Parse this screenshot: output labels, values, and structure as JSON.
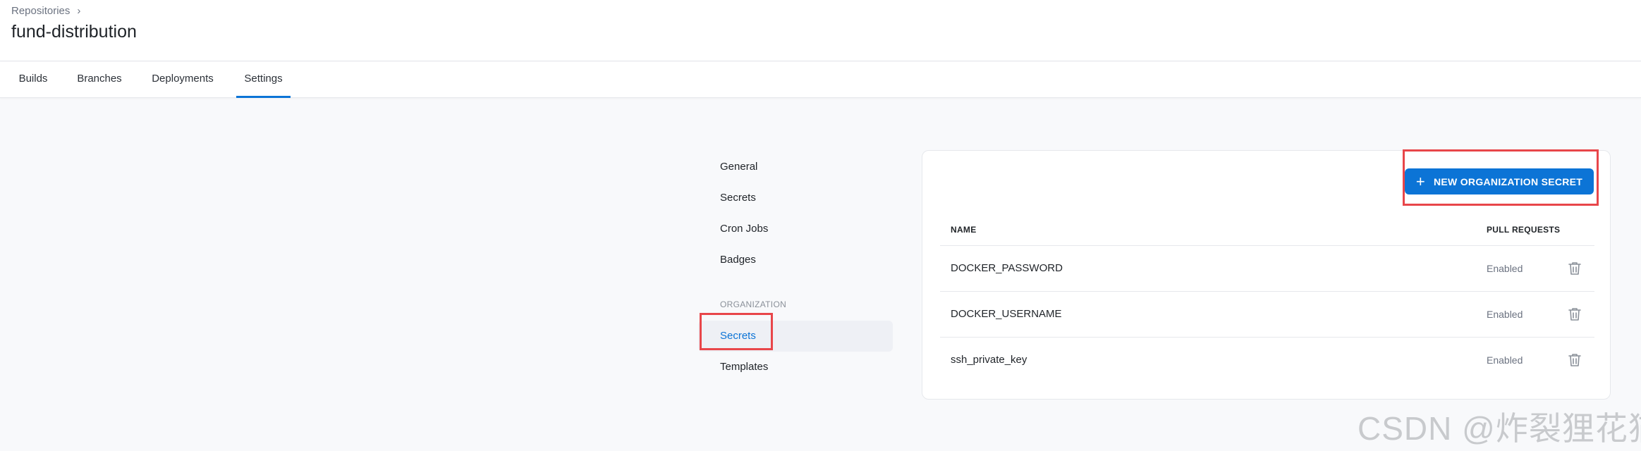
{
  "header": {
    "breadcrumb": "Repositories",
    "title": "fund-distribution"
  },
  "tabs": [
    {
      "label": "Builds"
    },
    {
      "label": "Branches"
    },
    {
      "label": "Deployments"
    },
    {
      "label": "Settings",
      "active": true
    }
  ],
  "sidebar": {
    "items": [
      {
        "label": "General"
      },
      {
        "label": "Secrets"
      },
      {
        "label": "Cron Jobs"
      },
      {
        "label": "Badges"
      }
    ],
    "section_label": "ORGANIZATION",
    "org_items": [
      {
        "label": "Secrets",
        "active": true
      },
      {
        "label": "Templates"
      }
    ]
  },
  "panel": {
    "new_button_label": "NEW ORGANIZATION SECRET",
    "columns": [
      "NAME",
      "PULL REQUESTS"
    ],
    "rows": [
      {
        "name": "DOCKER_PASSWORD",
        "pull_requests": "Enabled"
      },
      {
        "name": "DOCKER_USERNAME",
        "pull_requests": "Enabled"
      },
      {
        "name": "ssh_private_key",
        "pull_requests": "Enabled"
      }
    ]
  },
  "watermark": "CSDN @炸裂狸花猫",
  "colors": {
    "accent": "#0c74d6",
    "highlight_box": "#e8464a"
  }
}
